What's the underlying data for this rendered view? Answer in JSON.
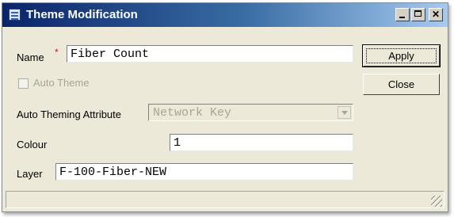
{
  "window": {
    "title": "Theme Modification"
  },
  "form": {
    "name_label": "Name",
    "required_mark": "*",
    "name_value": "Fiber Count",
    "auto_theme_label": "Auto Theme",
    "auto_theme_checked": false,
    "auto_attr_label": "Auto Theming Attribute",
    "auto_attr_value": "Network Key",
    "colour_label": "Colour",
    "colour_value": "1",
    "layer_label": "Layer",
    "layer_value": "F-100-Fiber-NEW"
  },
  "buttons": {
    "apply_label": "Apply",
    "close_label": "Close"
  },
  "colors": {
    "title_gradient_start": "#0a246a",
    "title_gradient_end": "#a6caf0",
    "window_bg": "#ece9d8",
    "required": "#dd1111",
    "disabled_text": "#a8a595"
  }
}
